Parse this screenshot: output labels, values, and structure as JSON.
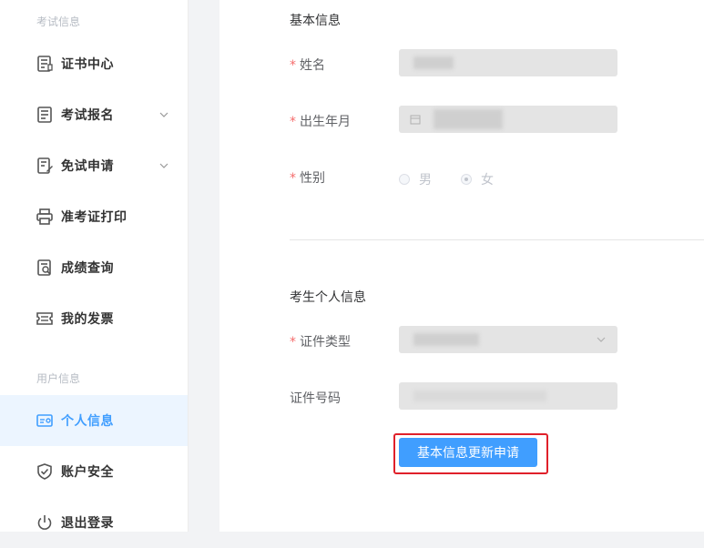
{
  "sidebar": {
    "groups": [
      {
        "title": "考试信息"
      },
      {
        "title": "用户信息"
      }
    ],
    "items": [
      {
        "label": "证书中心",
        "icon": "certificate-icon"
      },
      {
        "label": "考试报名",
        "icon": "document-icon",
        "expandable": true
      },
      {
        "label": "免试申请",
        "icon": "edit-document-icon",
        "expandable": true
      },
      {
        "label": "准考证打印",
        "icon": "printer-icon"
      },
      {
        "label": "成绩查询",
        "icon": "search-document-icon"
      },
      {
        "label": "我的发票",
        "icon": "ticket-icon"
      },
      {
        "label": "个人信息",
        "icon": "id-card-icon",
        "active": true
      },
      {
        "label": "账户安全",
        "icon": "shield-icon"
      },
      {
        "label": "退出登录",
        "icon": "power-icon"
      }
    ],
    "accent_color": "#409eff"
  },
  "basic_info": {
    "title": "基本信息",
    "name_label": "姓名",
    "birth_label": "出生年月",
    "gender_label": "性别",
    "gender_options": [
      "男",
      "女"
    ],
    "gender_selected": "女",
    "required_mark": "*"
  },
  "personal_info": {
    "title": "考生个人信息",
    "id_type_label": "证件类型",
    "id_number_label": "证件号码",
    "required_mark": "*"
  },
  "actions": {
    "submit_label": "基本信息更新申请"
  }
}
